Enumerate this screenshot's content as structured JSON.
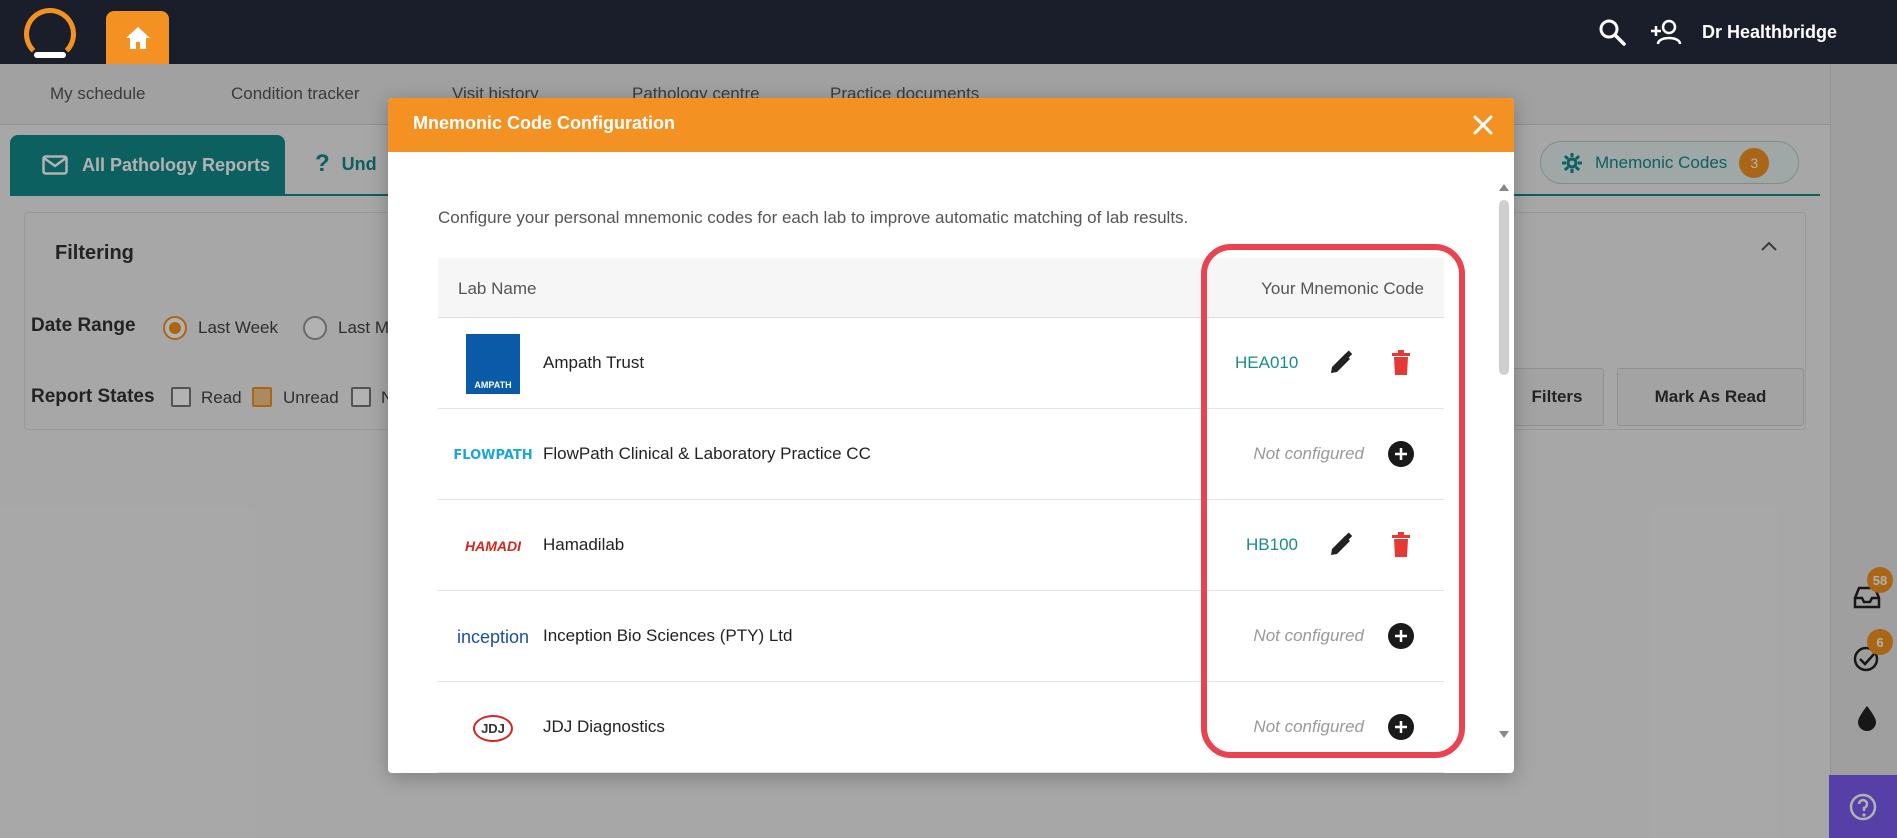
{
  "header": {
    "user_name": "Dr Healthbridge",
    "icons": [
      "search-icon",
      "add-user-icon"
    ]
  },
  "nav": {
    "items": [
      "My schedule",
      "Condition tracker",
      "Visit history",
      "Pathology centre",
      "Practice documents"
    ]
  },
  "tabs": {
    "active_label": "All Pathology Reports",
    "second_label": "Und",
    "mnemonic_label": "Mnemonic Codes",
    "mnemonic_count": "3"
  },
  "filtering": {
    "title": "Filtering",
    "date_range_label": "Date Range",
    "date_options": [
      "Last Week",
      "Last M"
    ],
    "date_selected": "Last Week",
    "report_states_label": "Report States",
    "state_options": [
      {
        "label": "Read",
        "checked": false
      },
      {
        "label": "Unread",
        "checked": true
      },
      {
        "label": "N",
        "checked": false
      }
    ],
    "filters_button": "Filters",
    "mark_read_button": "Mark As Read"
  },
  "rail": {
    "badge_1": "58",
    "badge_2": "6"
  },
  "modal": {
    "title": "Mnemonic Code Configuration",
    "description": "Configure your personal mnemonic codes for each lab to improve automatic matching of lab results.",
    "col_lab_name": "Lab Name",
    "col_mnemonic": "Your Mnemonic Code",
    "rows": [
      {
        "lab": "Ampath Trust",
        "code": "HEA010",
        "configured": true,
        "logo_text": "AMPATH",
        "logo_color": "#0a5aa8"
      },
      {
        "lab": "FlowPath Clinical & Laboratory Practice CC",
        "code": "Not configured",
        "configured": false,
        "logo_text": "FLOWPATH",
        "logo_color": "#1aa7d8"
      },
      {
        "lab": "Hamadilab",
        "code": "HB100",
        "configured": true,
        "logo_text": "HAMADI",
        "logo_color": "#d7261e"
      },
      {
        "lab": "Inception Bio Sciences (PTY) Ltd",
        "code": "Not configured",
        "configured": false,
        "logo_text": "inception",
        "logo_color": "#1b4f9c"
      },
      {
        "lab": "JDJ Diagnostics",
        "code": "Not configured",
        "configured": false,
        "logo_text": "JDJ",
        "logo_color": "#333333"
      }
    ]
  },
  "colors": {
    "accent": "#f39222",
    "teal": "#138a8a",
    "danger": "#e53935",
    "highlight": "#e8434f"
  }
}
